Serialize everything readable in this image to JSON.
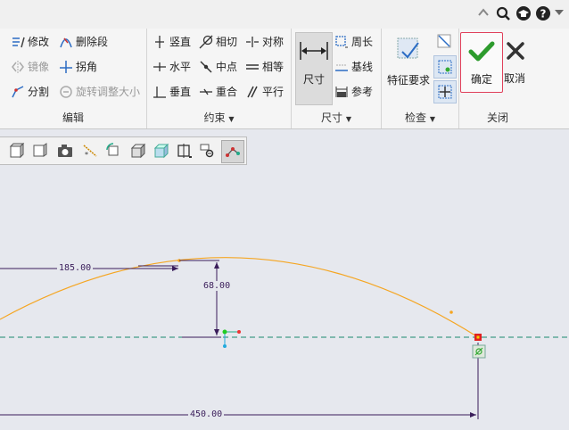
{
  "topbar": {
    "icons": [
      "collapse-up-icon",
      "search-icon",
      "cap-icon",
      "help-icon"
    ]
  },
  "groups": {
    "edit": {
      "label": "编辑",
      "modify": "修改",
      "delete_segment": "删除段",
      "mirror": "镜像",
      "corner": "拐角",
      "divide": "分割",
      "rotate_resize": "旋转调整大小"
    },
    "constrain": {
      "label": "约束",
      "vertical": "竖直",
      "tangent": "相切",
      "symmetric": "对称",
      "horizontal": "水平",
      "midpoint": "中点",
      "equal": "相等",
      "perpendicular": "垂直",
      "coincident": "重合",
      "parallel": "平行"
    },
    "dimension": {
      "label": "尺寸",
      "dimension": "尺寸",
      "perimeter": "周长",
      "baseline": "基线",
      "reference": "参考"
    },
    "inspect": {
      "label": "检查",
      "feature_requirements": "特征要求"
    },
    "close": {
      "label": "关闭",
      "ok": "确定",
      "cancel": "取消"
    }
  },
  "dims": {
    "d1": "185.00",
    "d2": "68.00",
    "d3": "450.00"
  },
  "colors": {
    "arc": "#f5a623",
    "dim": "#3a1d5a",
    "centerline": "#1a8a6e",
    "ok_border": "#e0405a",
    "ok_check": "#2d9b2d"
  }
}
